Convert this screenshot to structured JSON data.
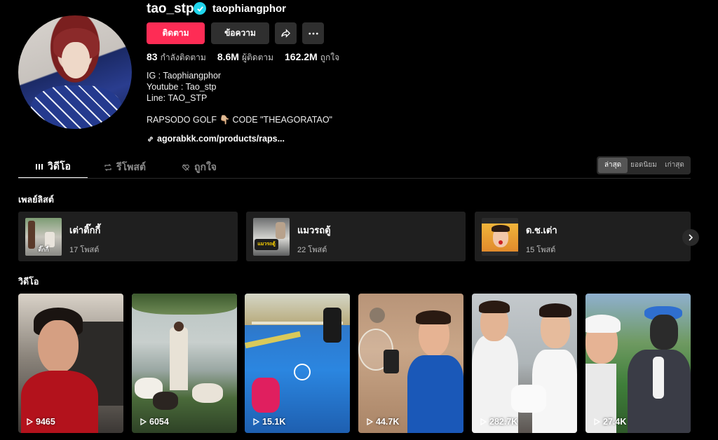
{
  "profile": {
    "username": "tao_stp",
    "nickname": "taophiangphor",
    "follow_label": "ติดตาม",
    "message_label": "ข้อความ",
    "stats": [
      {
        "num": "83",
        "label": "กำลังติดตาม"
      },
      {
        "num": "8.6M",
        "label": "ผู้ติดตาม"
      },
      {
        "num": "162.2M",
        "label": "ถูกใจ"
      }
    ],
    "bio_lines": [
      "IG : Taophiangphor",
      "Youtube : Tao_stp",
      "Line: TAO_STP"
    ],
    "bio_promo": "RAPSODO GOLF 👇🏼 CODE \"THEAGORATAO\"",
    "link": "agorabkk.com/products/raps..."
  },
  "tabs": [
    {
      "label": "วิดีโอ",
      "icon": "grid-icon"
    },
    {
      "label": "รีโพสต์",
      "icon": "repost-icon"
    },
    {
      "label": "ถูกใจ",
      "icon": "heart-off-icon"
    }
  ],
  "sort": [
    "ล่าสุด",
    "ยอดนิยม",
    "เก่าสุด"
  ],
  "playlists_title": "เพลย์ลิสต์",
  "playlists": [
    {
      "title": "เต่าติ๊กกี้",
      "count": "17 โพสต์",
      "thumb_text": "ติ๊กกี้"
    },
    {
      "title": "แมวรถตู้",
      "count": "22 โพสต์",
      "thumb_text": "แมวรถตู้"
    },
    {
      "title": "ด.ช.เต่า",
      "count": "15 โพสต์"
    }
  ],
  "videos_title": "วิดีโอ",
  "videos": [
    {
      "views": "9465"
    },
    {
      "views": "6054"
    },
    {
      "views": "15.1K"
    },
    {
      "views": "44.7K"
    },
    {
      "views": "282.7K"
    },
    {
      "views": "27.4K"
    }
  ],
  "colors": {
    "accent": "#fe2c55",
    "verified": "#20d5ec",
    "background": "#000000",
    "card": "#1f1f1f"
  }
}
